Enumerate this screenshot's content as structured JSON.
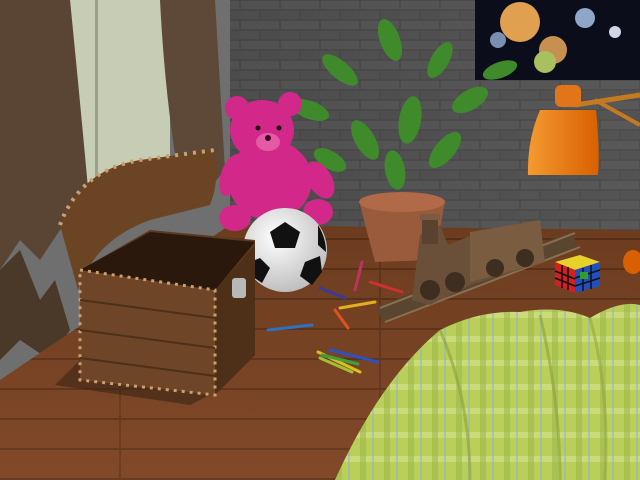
{
  "scene": {
    "objects": [
      "curtains",
      "window",
      "brick-wall",
      "potted-plant",
      "space-poster",
      "desk-lamp",
      "teddy-bear",
      "soccer-ball",
      "treasure-chest",
      "toy-train",
      "train-track",
      "rubiks-cube",
      "colored-pencils",
      "blanket",
      "wooden-floor"
    ],
    "colors": {
      "floor": "#7a4424",
      "brick": "#4a4a4a",
      "curtain": "#5a4434",
      "teddy": "#d1288a",
      "lamp": "#f07a12",
      "chest": "#5c3a1e",
      "blanket": "#b9cf5a",
      "plant": "#3f8a2a",
      "pot": "#9a5a3c",
      "train": "#6a5038"
    }
  }
}
